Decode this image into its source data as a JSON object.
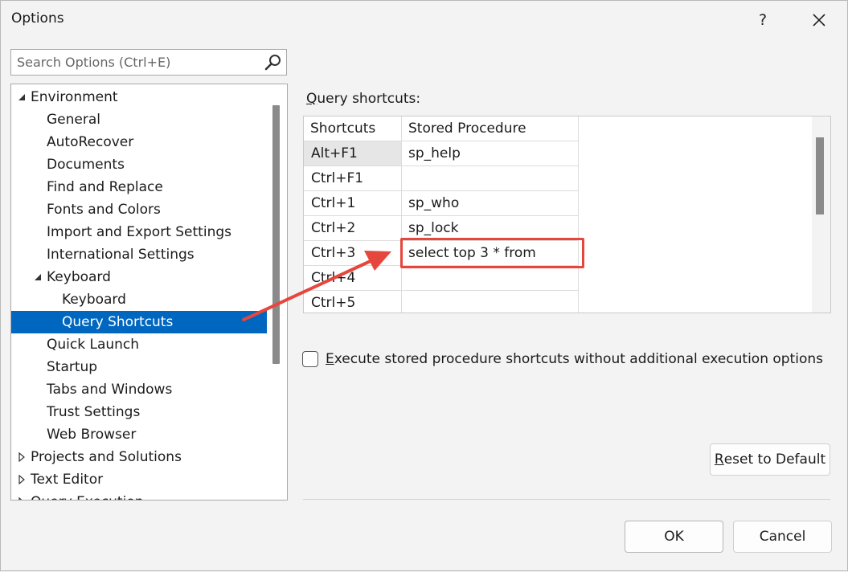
{
  "window": {
    "title": "Options",
    "help_label": "?",
    "close_label": "✕"
  },
  "search": {
    "placeholder": "Search Options (Ctrl+E)",
    "icon": "search-icon"
  },
  "tree": {
    "items": [
      {
        "label": "Environment",
        "level": 0,
        "expanded": true
      },
      {
        "label": "General",
        "level": 1
      },
      {
        "label": "AutoRecover",
        "level": 1
      },
      {
        "label": "Documents",
        "level": 1
      },
      {
        "label": "Find and Replace",
        "level": 1
      },
      {
        "label": "Fonts and Colors",
        "level": 1
      },
      {
        "label": "Import and Export Settings",
        "level": 1
      },
      {
        "label": "International Settings",
        "level": 1
      },
      {
        "label": "Keyboard",
        "level": 1,
        "expanded": true
      },
      {
        "label": "Keyboard",
        "level": 2
      },
      {
        "label": "Query Shortcuts",
        "level": 2,
        "selected": true
      },
      {
        "label": "Quick Launch",
        "level": 1
      },
      {
        "label": "Startup",
        "level": 1
      },
      {
        "label": "Tabs and Windows",
        "level": 1
      },
      {
        "label": "Trust Settings",
        "level": 1
      },
      {
        "label": "Web Browser",
        "level": 1
      },
      {
        "label": "Projects and Solutions",
        "level": 0,
        "expanded": false
      },
      {
        "label": "Text Editor",
        "level": 0,
        "expanded": false
      },
      {
        "label": "Query Execution",
        "level": 0,
        "expanded": false
      }
    ]
  },
  "query_shortcuts": {
    "label_prefix": "Q",
    "label_rest": "uery shortcuts:",
    "columns": [
      "Shortcuts",
      "Stored Procedure"
    ],
    "rows": [
      {
        "shortcut": "Alt+F1",
        "procedure": "sp_help"
      },
      {
        "shortcut": "Ctrl+F1",
        "procedure": ""
      },
      {
        "shortcut": "Ctrl+1",
        "procedure": "sp_who"
      },
      {
        "shortcut": "Ctrl+2",
        "procedure": "sp_lock"
      },
      {
        "shortcut": "Ctrl+3",
        "procedure": "select top 3 * from"
      },
      {
        "shortcut": "Ctrl+4",
        "procedure": ""
      },
      {
        "shortcut": "Ctrl+5",
        "procedure": ""
      }
    ]
  },
  "options": {
    "execute_checkbox_mnemonic": "E",
    "execute_checkbox_rest": "xecute stored procedure shortcuts without additional execution options",
    "execute_checked": false
  },
  "buttons": {
    "reset_mnemonic": "R",
    "reset_rest": "eset to Default",
    "ok": "OK",
    "cancel": "Cancel"
  },
  "colors": {
    "selection": "#0067c0",
    "annotation": "#e5463d"
  }
}
